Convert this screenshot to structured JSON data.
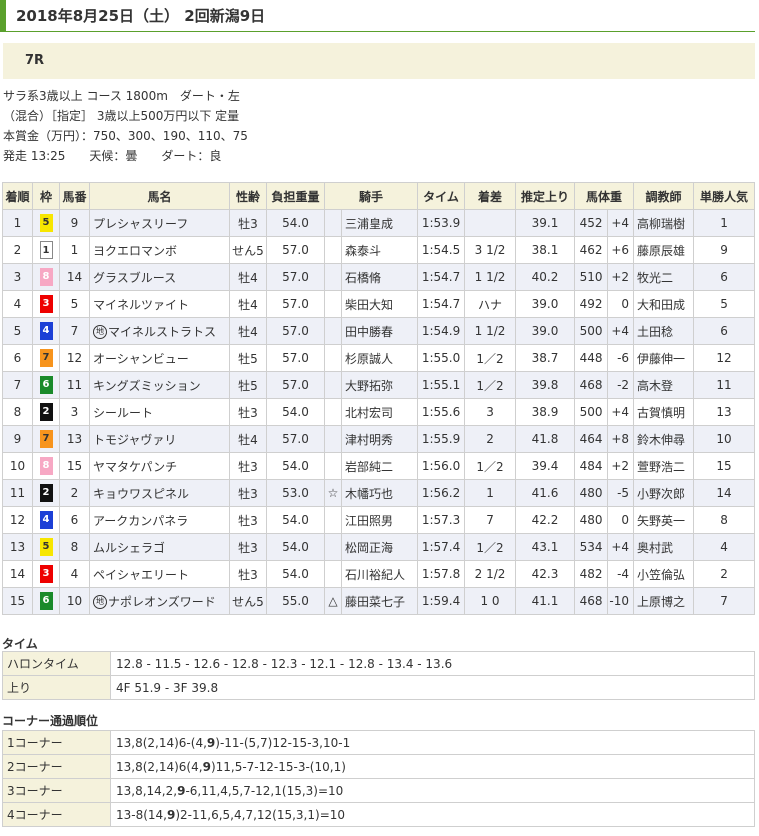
{
  "header": {
    "title": "2018年8月25日（土） 2回新潟9日"
  },
  "race": {
    "number": "7R",
    "info_lines": [
      "サラ系3歳以上 コース 1800m　ダート・左",
      "（混合）［指定］ 3歳以上500万円以下 定量",
      "本賞金（万円）：750、300、190、110、75",
      "発走 13:25　　天候：曇　　ダート：良"
    ]
  },
  "results": {
    "headers": [
      "着順",
      "枠",
      "馬番",
      "馬名",
      "性齢",
      "負担重量",
      "",
      "騎手",
      "タイム",
      "着差",
      "推定上り",
      "馬体重",
      "",
      "調教師",
      "単勝人気"
    ],
    "rows": [
      {
        "pos": "1",
        "waku": "5",
        "num": "9",
        "mark": "",
        "name": "プレシャスリーフ",
        "sexage": "牡3",
        "weight": "54.0",
        "jmark": "",
        "jockey": "三浦皇成",
        "time": "1:53.9",
        "margin": "",
        "last": "39.1",
        "bw": "452",
        "diff": "+4",
        "trainer": "高柳瑞樹",
        "pop": "1"
      },
      {
        "pos": "2",
        "waku": "1",
        "num": "1",
        "mark": "",
        "name": "ヨクエロマンボ",
        "sexage": "せん5",
        "weight": "57.0",
        "jmark": "",
        "jockey": "森泰斗",
        "time": "1:54.5",
        "margin": "3 1/2",
        "last": "38.1",
        "bw": "462",
        "diff": "+6",
        "trainer": "藤原辰雄",
        "pop": "9"
      },
      {
        "pos": "3",
        "waku": "8",
        "num": "14",
        "mark": "",
        "name": "グラスブルース",
        "sexage": "牡4",
        "weight": "57.0",
        "jmark": "",
        "jockey": "石橋脩",
        "time": "1:54.7",
        "margin": "1 1/2",
        "last": "40.2",
        "bw": "510",
        "diff": "+2",
        "trainer": "牧光二",
        "pop": "6"
      },
      {
        "pos": "4",
        "waku": "3",
        "num": "5",
        "mark": "",
        "name": "マイネルツァイト",
        "sexage": "牡4",
        "weight": "57.0",
        "jmark": "",
        "jockey": "柴田大知",
        "time": "1:54.7",
        "margin": "ハナ",
        "last": "39.0",
        "bw": "492",
        "diff": "0",
        "trainer": "大和田成",
        "pop": "5"
      },
      {
        "pos": "5",
        "waku": "4",
        "num": "7",
        "mark": "地",
        "name": "マイネルストラトス",
        "sexage": "牡4",
        "weight": "57.0",
        "jmark": "",
        "jockey": "田中勝春",
        "time": "1:54.9",
        "margin": "1 1/2",
        "last": "39.0",
        "bw": "500",
        "diff": "+4",
        "trainer": "土田稔",
        "pop": "6"
      },
      {
        "pos": "6",
        "waku": "7",
        "num": "12",
        "mark": "",
        "name": "オーシャンビュー",
        "sexage": "牡5",
        "weight": "57.0",
        "jmark": "",
        "jockey": "杉原誠人",
        "time": "1:55.0",
        "margin": "1／2",
        "last": "38.7",
        "bw": "448",
        "diff": "-6",
        "trainer": "伊藤伸一",
        "pop": "12"
      },
      {
        "pos": "7",
        "waku": "6",
        "num": "11",
        "mark": "",
        "name": "キングズミッション",
        "sexage": "牡5",
        "weight": "57.0",
        "jmark": "",
        "jockey": "大野拓弥",
        "time": "1:55.1",
        "margin": "1／2",
        "last": "39.8",
        "bw": "468",
        "diff": "-2",
        "trainer": "高木登",
        "pop": "11"
      },
      {
        "pos": "8",
        "waku": "2",
        "num": "3",
        "mark": "",
        "name": "シールート",
        "sexage": "牡3",
        "weight": "54.0",
        "jmark": "",
        "jockey": "北村宏司",
        "time": "1:55.6",
        "margin": "3",
        "last": "38.9",
        "bw": "500",
        "diff": "+4",
        "trainer": "古賀慎明",
        "pop": "13"
      },
      {
        "pos": "9",
        "waku": "7",
        "num": "13",
        "mark": "",
        "name": "トモジャヴァリ",
        "sexage": "牡4",
        "weight": "57.0",
        "jmark": "",
        "jockey": "津村明秀",
        "time": "1:55.9",
        "margin": "2",
        "last": "41.8",
        "bw": "464",
        "diff": "+8",
        "trainer": "鈴木伸尋",
        "pop": "10"
      },
      {
        "pos": "10",
        "waku": "8",
        "num": "15",
        "mark": "",
        "name": "ヤマタケパンチ",
        "sexage": "牡3",
        "weight": "54.0",
        "jmark": "",
        "jockey": "岩部純二",
        "time": "1:56.0",
        "margin": "1／2",
        "last": "39.4",
        "bw": "484",
        "diff": "+2",
        "trainer": "萱野浩二",
        "pop": "15"
      },
      {
        "pos": "11",
        "waku": "2",
        "num": "2",
        "mark": "",
        "name": "キョウワスピネル",
        "sexage": "牡3",
        "weight": "53.0",
        "jmark": "☆",
        "jockey": "木幡巧也",
        "time": "1:56.2",
        "margin": "1",
        "last": "41.6",
        "bw": "480",
        "diff": "-5",
        "trainer": "小野次郎",
        "pop": "14"
      },
      {
        "pos": "12",
        "waku": "4",
        "num": "6",
        "mark": "",
        "name": "アークカンパネラ",
        "sexage": "牡3",
        "weight": "54.0",
        "jmark": "",
        "jockey": "江田照男",
        "time": "1:57.3",
        "margin": "7",
        "last": "42.2",
        "bw": "480",
        "diff": "0",
        "trainer": "矢野英一",
        "pop": "8"
      },
      {
        "pos": "13",
        "waku": "5",
        "num": "8",
        "mark": "",
        "name": "ムルシェラゴ",
        "sexage": "牡3",
        "weight": "54.0",
        "jmark": "",
        "jockey": "松岡正海",
        "time": "1:57.4",
        "margin": "1／2",
        "last": "43.1",
        "bw": "534",
        "diff": "+4",
        "trainer": "奥村武",
        "pop": "4"
      },
      {
        "pos": "14",
        "waku": "3",
        "num": "4",
        "mark": "",
        "name": "ペイシャエリート",
        "sexage": "牡3",
        "weight": "54.0",
        "jmark": "",
        "jockey": "石川裕紀人",
        "time": "1:57.8",
        "margin": "2 1/2",
        "last": "42.3",
        "bw": "482",
        "diff": "-4",
        "trainer": "小笠倫弘",
        "pop": "2"
      },
      {
        "pos": "15",
        "waku": "6",
        "num": "10",
        "mark": "地",
        "name": "ナポレオンズワード",
        "sexage": "せん5",
        "weight": "55.0",
        "jmark": "△",
        "jockey": "藤田菜七子",
        "time": "1:59.4",
        "margin": "1 0",
        "last": "41.1",
        "bw": "468",
        "diff": "-10",
        "trainer": "上原博之",
        "pop": "7"
      }
    ]
  },
  "time_section": {
    "title": "タイム",
    "rows": [
      {
        "label": "ハロンタイム",
        "value": "12.8 - 11.5 - 12.6 - 12.8 - 12.3 - 12.1 - 12.8 - 13.4 - 13.6"
      },
      {
        "label": "上り",
        "value": "4F 51.9 - 3F 39.8"
      }
    ]
  },
  "corner_section": {
    "title": "コーナー通過順位",
    "rows": [
      {
        "label": "1コーナー",
        "pre": "13,8(2,14)6-(4,",
        "bold": "9",
        "post": ")-11-(5,7)12-15-3,10-1"
      },
      {
        "label": "2コーナー",
        "pre": "13,8(2,14)6(4,",
        "bold": "9",
        "post": ")11,5-7-12-15-3-(10,1)"
      },
      {
        "label": "3コーナー",
        "pre": "13,8,14,2,",
        "bold": "9",
        "post": "-6,11,4,5,7-12,1(15,3)=10"
      },
      {
        "label": "4コーナー",
        "pre": "13-8(14,",
        "bold": "9",
        "post": ")2-11,6,5,4,7,12(15,3,1)=10"
      }
    ]
  }
}
